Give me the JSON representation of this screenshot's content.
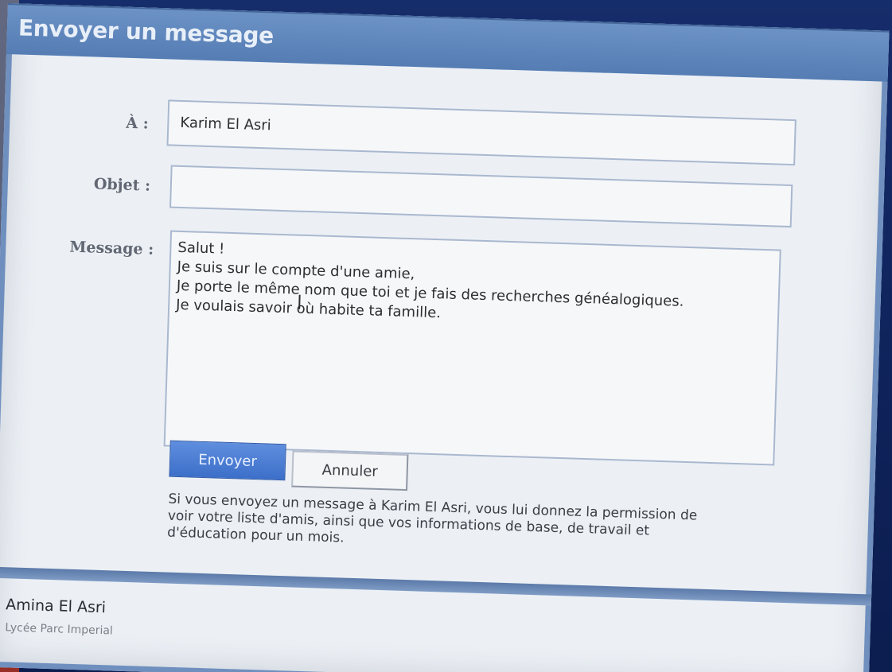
{
  "dialog": {
    "title": "Envoyer un message"
  },
  "form": {
    "to_label": "À :",
    "to_value": "Karim El Asri",
    "subject_label": "Objet :",
    "subject_value": "",
    "message_label": "Message :",
    "message_lines": [
      "Salut !",
      "Je suis sur le compte d'une amie,",
      "Je porte le même nom que toi et je fais des recherches généalogiques.",
      "Je voulais savoir où habite ta famille."
    ]
  },
  "buttons": {
    "send_label": "Envoyer",
    "cancel_label": "Annuler"
  },
  "notice": {
    "lines": [
      "Si vous envoyez un message à Karim El Asri, vous lui donnez la permission de",
      "voir votre liste d'amis, ainsi que vos informations de base, de travail et",
      "d'éducation pour un mois."
    ]
  },
  "footer": {
    "user_name": "Amina El Asri",
    "user_school": "Lycée Parc Imperial"
  },
  "colors": {
    "title_bar": "#5a81b7",
    "dialog_background": "#ecf0f5",
    "primary_button": "#3c6fc9",
    "field_border": "#a9b8cf"
  }
}
